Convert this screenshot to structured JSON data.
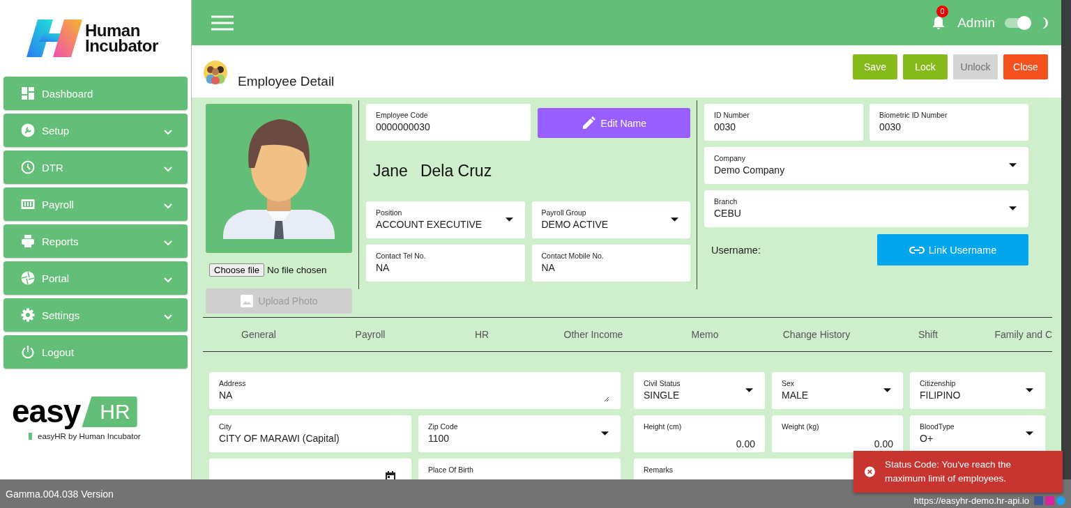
{
  "sidebar": {
    "logo": {
      "line1": "Human",
      "line2": "Incubator"
    },
    "items": [
      {
        "label": "Dashboard",
        "has_submenu": false
      },
      {
        "label": "Setup",
        "has_submenu": true
      },
      {
        "label": "DTR",
        "has_submenu": true
      },
      {
        "label": "Payroll",
        "has_submenu": true
      },
      {
        "label": "Reports",
        "has_submenu": true
      },
      {
        "label": "Portal",
        "has_submenu": true
      },
      {
        "label": "Settings",
        "has_submenu": true
      },
      {
        "label": "Logout",
        "has_submenu": false
      }
    ],
    "brand": {
      "word": "easy",
      "badge": "HR",
      "tagline": "easyHR by Human Incubator"
    }
  },
  "header": {
    "notification_count": "0",
    "user": "Admin",
    "dark_mode": {
      "on": true
    }
  },
  "page": {
    "title": "Employee Detail",
    "actions": [
      {
        "label": "Save",
        "kind": "confirm",
        "disabled": false
      },
      {
        "label": "Lock",
        "kind": "confirm",
        "disabled": false
      },
      {
        "label": "Unlock",
        "disabled": true
      },
      {
        "label": "Close",
        "kind": "danger",
        "disabled": false
      }
    ]
  },
  "photo": {
    "file_button": "Choose file",
    "file_status": "No file chosen",
    "upload": {
      "label": "Upload Photo",
      "disabled": true
    }
  },
  "employee": {
    "code": {
      "label": "Employee Code",
      "value": "0000000030"
    },
    "edit_button": "Edit Name",
    "first_name": "Jane",
    "last_name": "Dela Cruz",
    "fields": [
      {
        "label": "Position",
        "value": "ACCOUNT EXECUTIVE",
        "kind": "select"
      },
      {
        "label": "Payroll Group",
        "value": "DEMO ACTIVE",
        "kind": "select"
      },
      {
        "label": "Contact Tel No.",
        "value": "NA",
        "kind": "text"
      },
      {
        "label": "Contact Mobile No.",
        "value": "NA",
        "kind": "text"
      }
    ]
  },
  "ids": {
    "fields": [
      {
        "label": "ID Number",
        "value": "0030",
        "kind": "text",
        "wide": false
      },
      {
        "label": "Biometric ID Number",
        "value": "0030",
        "kind": "text",
        "wide": false
      },
      {
        "label": "Company",
        "value": "Demo Company",
        "kind": "select",
        "wide": true
      },
      {
        "label": "Branch",
        "value": "CEBU",
        "kind": "select",
        "wide": true
      }
    ],
    "username_label": "Username:",
    "link_button": "Link Username"
  },
  "tabs": [
    "General",
    "Payroll",
    "HR",
    "Other Income",
    "Memo",
    "Change History",
    "Shift",
    "Family and C"
  ],
  "form": {
    "left": [
      {
        "label": "Address",
        "value": "NA",
        "kind": "textarea",
        "wide": true
      },
      {
        "label": "City",
        "value": "CITY OF MARAWI (Capital)",
        "kind": "text",
        "wide": false
      },
      {
        "label": "Zip Code",
        "value": "1100",
        "kind": "select",
        "wide": false
      },
      {
        "kind": "date",
        "wide": false
      },
      {
        "label": "Place Of Birth",
        "kind": "text",
        "wide": false
      }
    ],
    "right": [
      {
        "label": "Civil Status",
        "value": "SINGLE",
        "kind": "select",
        "wide": false
      },
      {
        "label": "Sex",
        "value": "MALE",
        "kind": "select",
        "wide": false
      },
      {
        "label": "Citizenship",
        "value": "FILIPINO",
        "kind": "select",
        "wide": false
      },
      {
        "label": "Height (cm)",
        "value": "0.00",
        "kind": "number",
        "wide": false
      },
      {
        "label": "Weight (kg)",
        "value": "0.00",
        "kind": "number",
        "wide": false
      },
      {
        "label": "BloodType",
        "value": "O+",
        "kind": "select",
        "wide": false
      },
      {
        "label": "Remarks",
        "kind": "text",
        "wide": true
      }
    ]
  },
  "footer": {
    "version": "Gamma.004.038 Version",
    "url": "https://easyhr-demo.hr-api.io"
  },
  "toast": {
    "kind": "error",
    "message": "Status Code: You've reach the maximum limit of employees."
  }
}
